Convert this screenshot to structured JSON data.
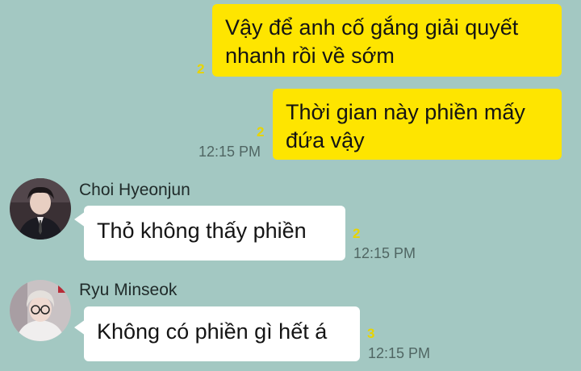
{
  "messages": [
    {
      "direction": "outgoing",
      "text_line1": "Vậy để anh cố gắng giải quyết",
      "text_line2": "nhanh rồi về sớm",
      "unread": "2",
      "time": ""
    },
    {
      "direction": "outgoing",
      "text_line1": "Thời gian này phiền mấy",
      "text_line2": "đứa vậy",
      "unread": "2",
      "time": "12:15 PM"
    },
    {
      "direction": "incoming",
      "sender": "Choi Hyeonjun",
      "avatar_icon": "user-avatar-photo-icon",
      "text": "Thỏ không thấy phiền",
      "unread": "2",
      "time": "12:15 PM"
    },
    {
      "direction": "incoming",
      "sender": "Ryu Minseok",
      "avatar_icon": "user-avatar-photo-icon",
      "text": "Không có phiền gì hết á",
      "unread": "3",
      "time": "12:15 PM"
    }
  ],
  "colors": {
    "background": "#a3c8c2",
    "outgoing_bubble": "#fee500",
    "incoming_bubble": "#ffffff",
    "unread_count": "#e8d400"
  }
}
